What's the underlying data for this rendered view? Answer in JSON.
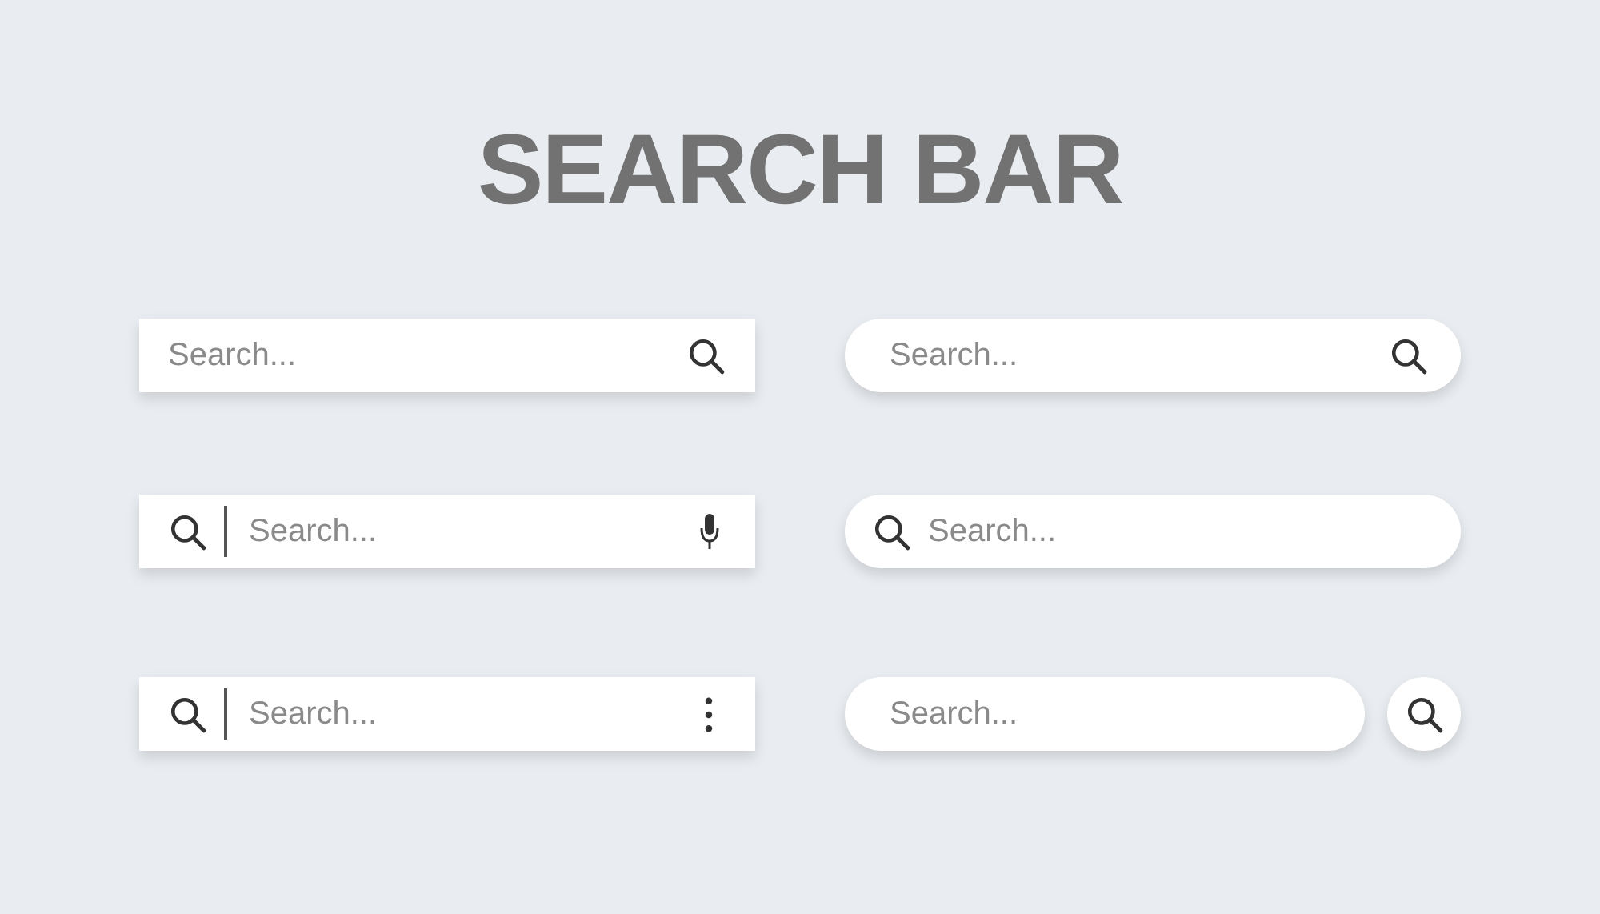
{
  "title": "SEARCH BAR",
  "search_bars": [
    {
      "kind": "square-icon-right",
      "placeholder": "Search..."
    },
    {
      "kind": "round-icon-right",
      "placeholder": "Search..."
    },
    {
      "kind": "square-icon-left-mic",
      "placeholder": "Search..."
    },
    {
      "kind": "round-icon-left",
      "placeholder": "Search..."
    },
    {
      "kind": "square-icon-left-menu",
      "placeholder": "Search..."
    },
    {
      "kind": "round-separate-button",
      "placeholder": "Search..."
    }
  ]
}
